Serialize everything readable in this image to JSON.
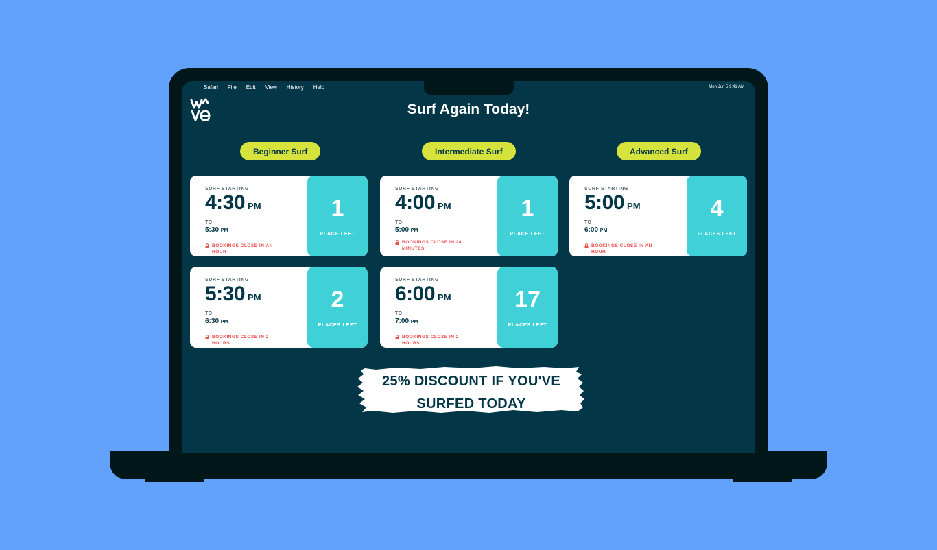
{
  "menubar": {
    "items": [
      "Safari",
      "File",
      "Edit",
      "View",
      "History",
      "Help"
    ],
    "clock": "Mon Jun 5  9:41 AM"
  },
  "logo": {
    "line1": "w^",
    "line2": "ve",
    "alt": "wave"
  },
  "page": {
    "title": "Surf Again Today!"
  },
  "levels": [
    {
      "label": "Beginner Surf"
    },
    {
      "label": "Intermediate Surf"
    },
    {
      "label": "Advanced Surf"
    }
  ],
  "colors": {
    "background": "#62a2fc",
    "screen": "#033747",
    "pill": "#d6e33c",
    "places": "#40d1d8",
    "warning": "#ef4b4b"
  },
  "cards": [
    {
      "level": "Beginner Surf",
      "label": "SURF STARTING",
      "start": "4:30",
      "start_ampm": "PM",
      "to": "TO",
      "end": "5:30",
      "end_ampm": "PM",
      "closing": "BOOKINGS CLOSE IN AN HOUR",
      "places": "1",
      "places_label": "PLACE LEFT"
    },
    {
      "level": "Intermediate Surf",
      "label": "SURF STARTING",
      "start": "4:00",
      "start_ampm": "PM",
      "to": "TO",
      "end": "5:00",
      "end_ampm": "PM",
      "closing": "BOOKINGS CLOSE IN 28 MINUTES",
      "places": "1",
      "places_label": "PLACE LEFT"
    },
    {
      "level": "Advanced Surf",
      "label": "SURF STARTING",
      "start": "5:00",
      "start_ampm": "PM",
      "to": "TO",
      "end": "6:00",
      "end_ampm": "PM",
      "closing": "BOOKINGS CLOSE IN AN HOUR",
      "places": "4",
      "places_label": "PLACES LEFT"
    },
    {
      "level": "Beginner Surf",
      "label": "SURF STARTING",
      "start": "5:30",
      "start_ampm": "PM",
      "to": "TO",
      "end": "6:30",
      "end_ampm": "PM",
      "closing": "BOOKINGS CLOSE IN 2 HOURS",
      "places": "2",
      "places_label": "PLACES LEFT"
    },
    {
      "level": "Intermediate Surf",
      "label": "SURF STARTING",
      "start": "6:00",
      "start_ampm": "PM",
      "to": "TO",
      "end": "7:00",
      "end_ampm": "PM",
      "closing": "BOOKINGS CLOSE IN 2 HOURS",
      "places": "17",
      "places_label": "PLACES LEFT"
    }
  ],
  "promo": {
    "line1": "25% DISCOUNT IF YOU'VE",
    "line2": "SURFED TODAY"
  }
}
